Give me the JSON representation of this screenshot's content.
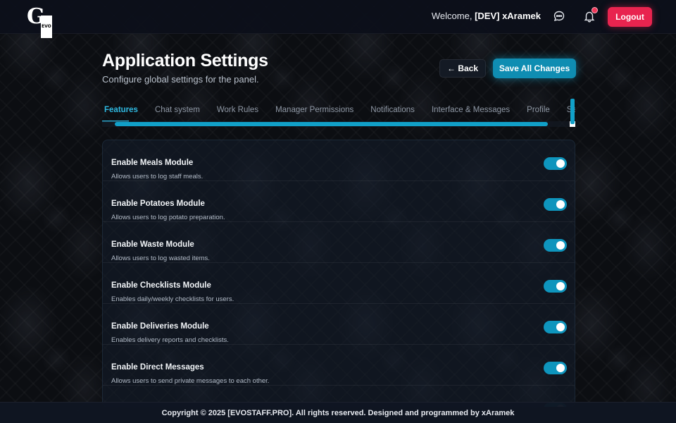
{
  "navbar": {
    "logo_text": "G",
    "logo_small": "EVO",
    "welcome_prefix": "Welcome,",
    "welcome_user": "[DEV] xAramek",
    "logout_label": "Logout"
  },
  "header": {
    "title": "Application Settings",
    "subtitle": "Configure global settings for the panel.",
    "back_label": "← Back",
    "save_label": "Save All Changes"
  },
  "tabs": [
    {
      "label": "Features",
      "active": true
    },
    {
      "label": "Chat system"
    },
    {
      "label": "Work Rules"
    },
    {
      "label": "Manager Permissions"
    },
    {
      "label": "Notifications"
    },
    {
      "label": "Interface & Messages"
    },
    {
      "label": "Profile"
    },
    {
      "label": "Security"
    }
  ],
  "settings": [
    {
      "label": "Enable Meals Module",
      "description": "Allows users to log staff meals.",
      "enabled": true
    },
    {
      "label": "Enable Potatoes Module",
      "description": "Allows users to log potato preparation.",
      "enabled": true
    },
    {
      "label": "Enable Waste Module",
      "description": "Allows users to log wasted items.",
      "enabled": true
    },
    {
      "label": "Enable Checklists Module",
      "description": "Enables daily/weekly checklists for users.",
      "enabled": true
    },
    {
      "label": "Enable Deliveries Module",
      "description": "Enables delivery reports and checklists.",
      "enabled": true
    },
    {
      "label": "Enable Direct Messages",
      "description": "Allows users to send private messages to each other.",
      "enabled": true
    },
    {
      "label": "",
      "description": "",
      "enabled": true
    }
  ],
  "footer": {
    "text": "Copyright © 2025 [EVOSTAFF.PRO]. All rights reserved. Designed and programmed by xAramek"
  },
  "colors": {
    "accent": "#0e95bd",
    "logout": "#e8244f",
    "notification_dot": "#f0385a"
  }
}
